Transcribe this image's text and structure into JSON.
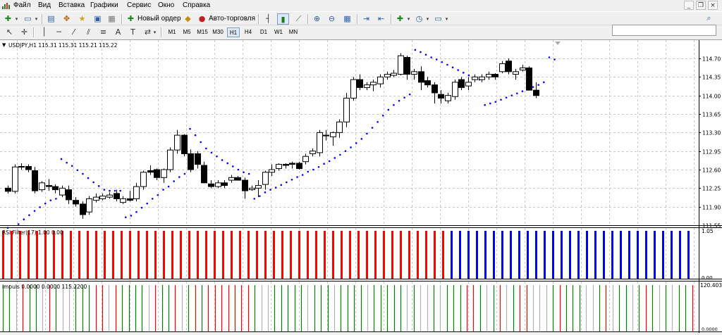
{
  "menu": {
    "items": [
      "Файл",
      "Вид",
      "Вставка",
      "Графики",
      "Сервис",
      "Окно",
      "Справка"
    ],
    "window_controls": [
      "_",
      "❐",
      "×"
    ]
  },
  "toolbar": {
    "new_order_label": "Новый ордер",
    "autotrading_label": "Авто-торговля"
  },
  "timeframes": [
    "M1",
    "M5",
    "M15",
    "M30",
    "H1",
    "H4",
    "D1",
    "W1",
    "MN"
  ],
  "active_timeframe": "H1",
  "chart": {
    "header": "USDJPY,H1  115.31 115.31 115.21 115.22",
    "price_ticks": [
      "114.70",
      "114.35",
      "114.00",
      "113.65",
      "113.30",
      "112.95",
      "112.60",
      "112.25",
      "111.90",
      "111.55"
    ],
    "candles": [
      [
        112.25,
        112.3,
        112.15,
        112.19
      ],
      [
        112.19,
        112.7,
        112.15,
        112.65
      ],
      [
        112.66,
        112.72,
        112.6,
        112.66
      ],
      [
        112.66,
        112.7,
        112.55,
        112.6
      ],
      [
        112.58,
        112.65,
        112.15,
        112.2
      ],
      [
        112.22,
        112.38,
        112.18,
        112.35
      ],
      [
        112.3,
        112.42,
        112.2,
        112.28
      ],
      [
        112.28,
        112.32,
        112.15,
        112.22
      ],
      [
        112.12,
        112.3,
        112.08,
        112.25
      ],
      [
        112.22,
        112.3,
        111.95,
        112.03
      ],
      [
        112.02,
        112.08,
        111.9,
        111.95
      ],
      [
        111.95,
        112.0,
        111.67,
        111.75
      ],
      [
        111.8,
        112.1,
        111.75,
        112.05
      ],
      [
        112.02,
        112.15,
        111.98,
        112.08
      ],
      [
        112.05,
        112.15,
        112.02,
        112.1
      ],
      [
        112.08,
        112.17,
        112.05,
        112.12
      ],
      [
        112.15,
        112.22,
        112.0,
        112.05
      ],
      [
        111.98,
        112.1,
        111.95,
        112.05
      ],
      [
        112.05,
        112.2,
        112.0,
        112.02
      ],
      [
        112.05,
        112.35,
        112.0,
        112.28
      ],
      [
        112.28,
        112.58,
        112.22,
        112.55
      ],
      [
        112.58,
        112.68,
        112.5,
        112.55
      ],
      [
        112.6,
        112.62,
        112.4,
        112.45
      ],
      [
        112.45,
        112.62,
        112.35,
        112.6
      ],
      [
        112.6,
        113.02,
        112.55,
        112.97
      ],
      [
        112.97,
        113.35,
        112.9,
        113.25
      ],
      [
        113.25,
        113.27,
        112.85,
        112.9
      ],
      [
        112.9,
        112.98,
        112.55,
        112.6
      ],
      [
        112.9,
        112.95,
        112.62,
        112.7
      ],
      [
        112.68,
        112.75,
        112.35,
        112.35
      ],
      [
        112.33,
        112.4,
        112.25,
        112.28
      ],
      [
        112.28,
        112.4,
        112.25,
        112.35
      ],
      [
        112.35,
        112.4,
        112.25,
        112.3
      ],
      [
        112.4,
        112.5,
        112.35,
        112.45
      ],
      [
        112.45,
        112.48,
        112.4,
        112.4
      ],
      [
        112.4,
        112.45,
        112.05,
        112.2
      ],
      [
        112.22,
        112.3,
        112.2,
        112.25
      ],
      [
        112.25,
        112.4,
        112.08,
        112.3
      ],
      [
        112.32,
        112.58,
        112.22,
        112.55
      ],
      [
        112.55,
        112.7,
        112.48,
        112.6
      ],
      [
        112.62,
        112.72,
        112.58,
        112.7
      ],
      [
        112.7,
        112.72,
        112.62,
        112.68
      ],
      [
        112.72,
        112.75,
        112.62,
        112.7
      ],
      [
        112.72,
        112.75,
        112.6,
        112.62
      ],
      [
        112.75,
        112.9,
        112.7,
        112.85
      ],
      [
        112.9,
        113.0,
        112.85,
        112.95
      ],
      [
        112.92,
        113.35,
        112.85,
        113.3
      ],
      [
        113.25,
        113.35,
        113.15,
        113.25
      ],
      [
        113.22,
        113.32,
        113.05,
        113.3
      ],
      [
        113.3,
        113.55,
        113.2,
        113.5
      ],
      [
        113.5,
        114.05,
        113.4,
        113.95
      ],
      [
        113.95,
        114.35,
        113.9,
        114.3
      ],
      [
        114.3,
        114.4,
        114.1,
        114.15
      ],
      [
        114.15,
        114.25,
        114.1,
        114.2
      ],
      [
        114.2,
        114.3,
        114.08,
        114.25
      ],
      [
        114.22,
        114.4,
        114.15,
        114.35
      ],
      [
        114.35,
        114.45,
        114.3,
        114.4
      ],
      [
        114.38,
        114.48,
        114.35,
        114.42
      ],
      [
        114.4,
        114.8,
        114.38,
        114.75
      ],
      [
        114.72,
        114.75,
        114.3,
        114.4
      ],
      [
        114.4,
        114.5,
        114.3,
        114.45
      ],
      [
        114.45,
        114.55,
        114.1,
        114.25
      ],
      [
        114.28,
        114.35,
        114.15,
        114.2
      ],
      [
        114.2,
        114.25,
        113.85,
        114.05
      ],
      [
        114.02,
        114.1,
        113.85,
        113.95
      ],
      [
        113.9,
        114.05,
        113.85,
        114.0
      ],
      [
        113.98,
        114.3,
        113.92,
        114.25
      ],
      [
        114.3,
        114.35,
        114.1,
        114.15
      ],
      [
        114.18,
        114.35,
        114.1,
        114.25
      ],
      [
        114.3,
        114.4,
        114.25,
        114.35
      ],
      [
        114.3,
        114.4,
        114.25,
        114.35
      ],
      [
        114.35,
        114.45,
        114.3,
        114.4
      ],
      [
        114.4,
        114.42,
        114.3,
        114.35
      ],
      [
        114.45,
        114.65,
        114.42,
        114.6
      ],
      [
        114.65,
        114.7,
        114.4,
        114.45
      ],
      [
        114.4,
        114.5,
        114.3,
        114.45
      ],
      [
        114.48,
        114.58,
        114.45,
        114.52
      ],
      [
        114.52,
        114.55,
        114.1,
        114.1
      ],
      [
        114.1,
        114.25,
        113.95,
        114.0
      ]
    ],
    "sar": [
      [
        0,
        111.5
      ],
      [
        2,
        111.57
      ],
      [
        3,
        111.66
      ],
      [
        4,
        111.74
      ],
      [
        5,
        111.82
      ],
      [
        6,
        111.89
      ],
      [
        7,
        111.96
      ],
      [
        8,
        112.02
      ],
      [
        9,
        112.05
      ],
      [
        10,
        112.8
      ],
      [
        11,
        112.73
      ],
      [
        12,
        112.67
      ],
      [
        13,
        112.59
      ],
      [
        14,
        112.52
      ],
      [
        15,
        112.44
      ],
      [
        16,
        112.36
      ],
      [
        17,
        112.29
      ],
      [
        18,
        112.22
      ],
      [
        19,
        112.2
      ],
      [
        20,
        112.2
      ],
      [
        21,
        112.2
      ],
      [
        22,
        111.7
      ],
      [
        23,
        111.73
      ],
      [
        24,
        111.8
      ],
      [
        25,
        111.88
      ],
      [
        26,
        111.96
      ],
      [
        27,
        112.05
      ],
      [
        28,
        112.12
      ],
      [
        29,
        112.22
      ],
      [
        30,
        112.28
      ],
      [
        31,
        112.38
      ],
      [
        32,
        112.46
      ],
      [
        33,
        112.52
      ],
      [
        34,
        113.37
      ],
      [
        35,
        113.25
      ],
      [
        36,
        113.12
      ],
      [
        37,
        113.0
      ],
      [
        38,
        112.92
      ],
      [
        39,
        112.85
      ],
      [
        40,
        112.78
      ],
      [
        41,
        112.72
      ],
      [
        42,
        112.66
      ],
      [
        43,
        112.6
      ],
      [
        44,
        112.55
      ],
      [
        45,
        112.52
      ],
      [
        46,
        112.05
      ],
      [
        47,
        112.1
      ],
      [
        48,
        112.17
      ],
      [
        49,
        112.22
      ],
      [
        50,
        112.26
      ],
      [
        51,
        112.31
      ],
      [
        52,
        112.36
      ],
      [
        53,
        112.41
      ],
      [
        54,
        112.46
      ],
      [
        55,
        112.5
      ],
      [
        56,
        112.56
      ],
      [
        57,
        112.6
      ],
      [
        58,
        112.65
      ],
      [
        59,
        112.71
      ],
      [
        60,
        112.76
      ],
      [
        61,
        112.82
      ],
      [
        62,
        112.88
      ],
      [
        63,
        112.95
      ],
      [
        64,
        113.02
      ],
      [
        65,
        113.1
      ],
      [
        66,
        113.18
      ],
      [
        67,
        113.28
      ],
      [
        68,
        113.39
      ],
      [
        69,
        113.5
      ],
      [
        70,
        113.62
      ],
      [
        71,
        113.73
      ],
      [
        72,
        113.82
      ],
      [
        73,
        113.9
      ],
      [
        74,
        113.96
      ],
      [
        75,
        114.02
      ],
      [
        76,
        114.86
      ],
      [
        77,
        114.82
      ],
      [
        78,
        114.77
      ],
      [
        79,
        114.72
      ],
      [
        80,
        114.68
      ],
      [
        81,
        114.63
      ],
      [
        82,
        114.58
      ],
      [
        83,
        114.53
      ],
      [
        84,
        114.48
      ],
      [
        85,
        114.43
      ],
      [
        86,
        114.38
      ],
      [
        87,
        114.34
      ],
      [
        88,
        114.3
      ],
      [
        89,
        113.82
      ],
      [
        90,
        113.85
      ],
      [
        91,
        113.88
      ],
      [
        92,
        113.92
      ],
      [
        93,
        113.96
      ],
      [
        94,
        114.0
      ],
      [
        95,
        114.04
      ],
      [
        96,
        114.08
      ],
      [
        97,
        114.12
      ],
      [
        98,
        114.16
      ],
      [
        99,
        114.2
      ],
      [
        100,
        114.25
      ],
      [
        101,
        114.72
      ],
      [
        102,
        114.68
      ]
    ],
    "sar_color": "#0000ff",
    "bull_color": "#ffffff",
    "bear_color": "#000000"
  },
  "rsi_filter": {
    "label": "RSI Filter(17) 1.00 0.00",
    "scale_top": "1.05",
    "scale_bottom": "0.00",
    "red_count": 53,
    "blue_count": 29,
    "red_color": "#ff0000",
    "blue_color": "#0000ff"
  },
  "impuls": {
    "label": "impuls 0.0000 0.0000 115.2200",
    "scale_top": "120.4035",
    "scale_bottom": "0.0000",
    "bars": "ggwrggwrgwwgggrrwrggggwrggrwgrgrrrrrrrgwwgggggwgggwggggwgggggwgwwgwgggrrgwgrwgrrwwwgrgggwwgrwggwgrgwgwggr",
    "green_color": "#008000",
    "red_color": "#ff0000",
    "gray_color": "#b0b0b0"
  }
}
